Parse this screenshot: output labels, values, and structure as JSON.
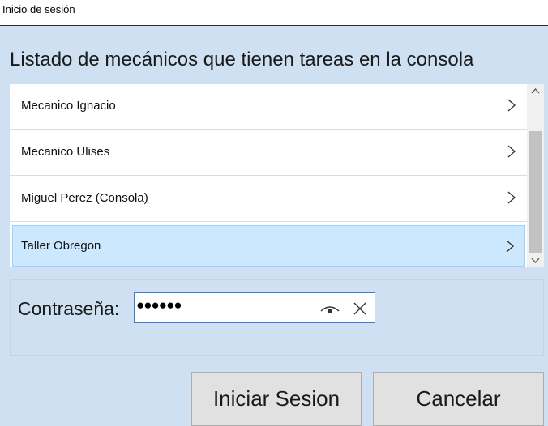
{
  "window": {
    "title": "Inicio de sesión"
  },
  "heading": "Listado de mecánicos que tienen tareas en la consola",
  "mechanics": [
    {
      "label": "Mecanico Ignacio",
      "selected": false
    },
    {
      "label": "Mecanico Ulises",
      "selected": false
    },
    {
      "label": "Miguel Perez (Consola)",
      "selected": false
    },
    {
      "label": "Taller Obregon",
      "selected": true
    }
  ],
  "password": {
    "label": "Contraseña:",
    "masked_value": "●●●●●●"
  },
  "buttons": {
    "login": "Iniciar Sesion",
    "cancel": "Cancelar"
  },
  "icons": {
    "chevron": "chevron-right-icon",
    "reveal": "eye-icon",
    "clear": "close-icon",
    "scroll_up": "chevron-up-icon",
    "scroll_down": "chevron-down-icon"
  },
  "colors": {
    "background": "#cfe0f3",
    "selected_item": "#cce8ff",
    "input_border": "#3c7dd4"
  }
}
